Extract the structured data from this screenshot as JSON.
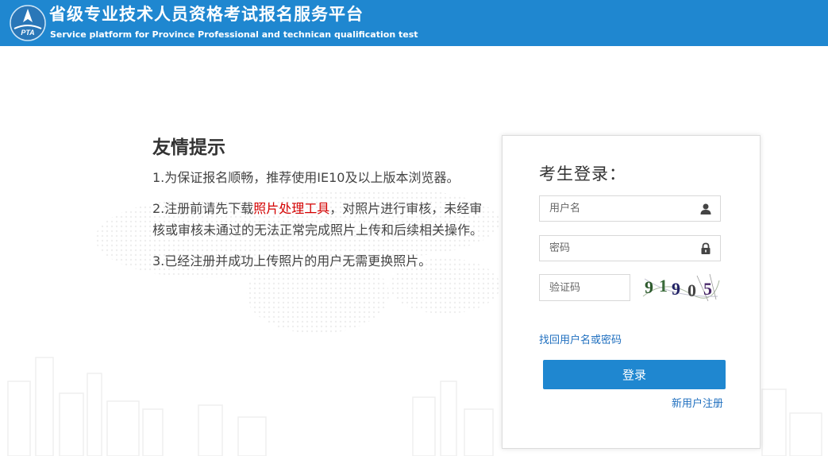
{
  "header": {
    "title_cn": "省级专业技术人员资格考试报名服务平台",
    "title_en": "Service platform for Province Professional and technican qualification test",
    "logo_text": "PTA",
    "color": "#1f87d0"
  },
  "notice": {
    "heading": "友情提示",
    "item1": "1.为保证报名顺畅，推荐使用IE10及以上版本浏览器。",
    "item2_before": "2.注册前请先下载",
    "item2_link": "照片处理工具",
    "item2_after": "，对照片进行审核，未经审核或审核未通过的无法正常完成照片上传和后续相关操作。",
    "item3": "3.已经注册并成功上传照片的用户无需更换照片。",
    "link_color": "#d40000"
  },
  "login": {
    "title": "考生登录：",
    "username_placeholder": "用户名",
    "username_icon": "user-icon",
    "password_placeholder": "密码",
    "password_icon": "lock-icon",
    "captcha_placeholder": "验证码",
    "captcha_code": "91905",
    "forgot_label": "找回用户名或密码",
    "login_button": "登录",
    "register_label": "新用户注册"
  }
}
